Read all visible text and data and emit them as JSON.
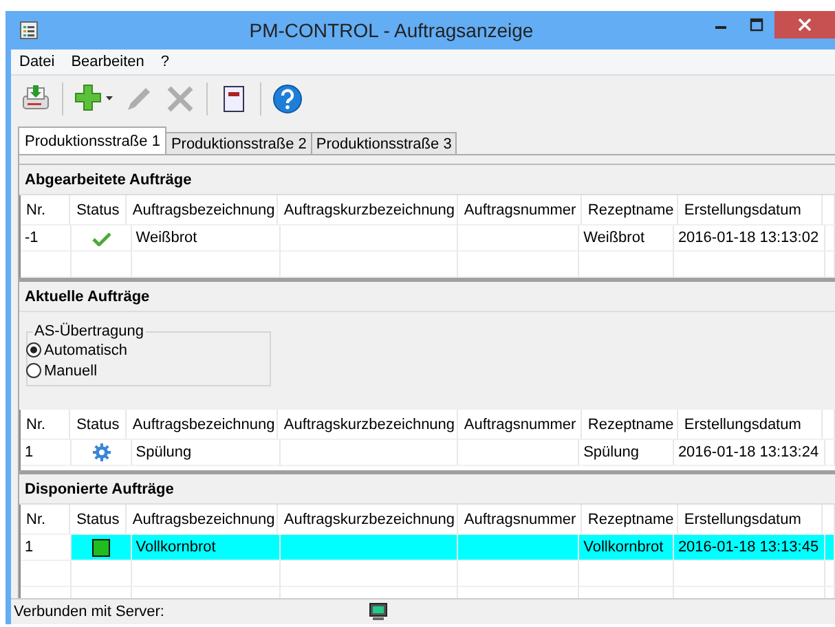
{
  "window": {
    "title": "PM-CONTROL - Auftragsanzeige"
  },
  "menu": [
    {
      "label": "Datei"
    },
    {
      "label": "Bearbeiten"
    },
    {
      "label": "?"
    }
  ],
  "toolbar": [
    {
      "kind": "import",
      "disabled": false
    },
    {
      "kind": "add",
      "disabled": false
    },
    {
      "kind": "edit",
      "disabled": true
    },
    {
      "kind": "delete",
      "disabled": true
    },
    {
      "kind": "report",
      "disabled": false
    },
    {
      "kind": "help",
      "disabled": false
    }
  ],
  "tabs": [
    {
      "label": "Produktionsstraße 1",
      "selected": true
    },
    {
      "label": "Produktionsstraße 2",
      "selected": false
    },
    {
      "label": "Produktionsstraße 3",
      "selected": false
    }
  ],
  "sections": [
    {
      "title": "Abgearbeitete Aufträge",
      "columns": [
        "Nr.",
        "Status",
        "Auftragsbezeichnung",
        "Auftragskurzbezeichnung",
        "Auftragsnummer",
        "Rezeptname",
        "Erstellungsdatum"
      ],
      "rows": [
        {
          "nr": "-1",
          "kind": "done",
          "name": "Weißbrot",
          "recipe": "Weißbrot",
          "created": "2016-01-18 13:13:02",
          "selected": false
        }
      ]
    },
    {
      "title": "Aktuelle Aufträge",
      "group_box": {
        "title": "AS-Übertragung",
        "options": [
          {
            "label": "Automatisch",
            "selected": true
          },
          {
            "label": "Manuell",
            "selected": false
          }
        ]
      },
      "columns": [
        "Nr.",
        "Status",
        "Auftragsbezeichnung",
        "Auftragskurzbezeichnung",
        "Auftragsnummer",
        "Rezeptname",
        "Erstellungsdatum"
      ],
      "rows": [
        {
          "nr": "1",
          "kind": "running",
          "name": "Spülung",
          "recipe": "Spülung",
          "created": "2016-01-18 13:13:24",
          "selected": false
        }
      ]
    },
    {
      "title": "Disponierte Aufträge",
      "columns": [
        "Nr.",
        "Status",
        "Auftragsbezeichnung",
        "Auftragskurzbezeichnung",
        "Auftragsnummer",
        "Rezeptname",
        "Erstellungsdatum"
      ],
      "rows": [
        {
          "nr": "1",
          "kind": "planned",
          "name": "Vollkornbrot",
          "recipe": "Vollkornbrot",
          "created": "2016-01-18 13:13:45",
          "selected": true
        }
      ]
    }
  ],
  "status_bar": {
    "text": "Verbunden mit Server:"
  }
}
